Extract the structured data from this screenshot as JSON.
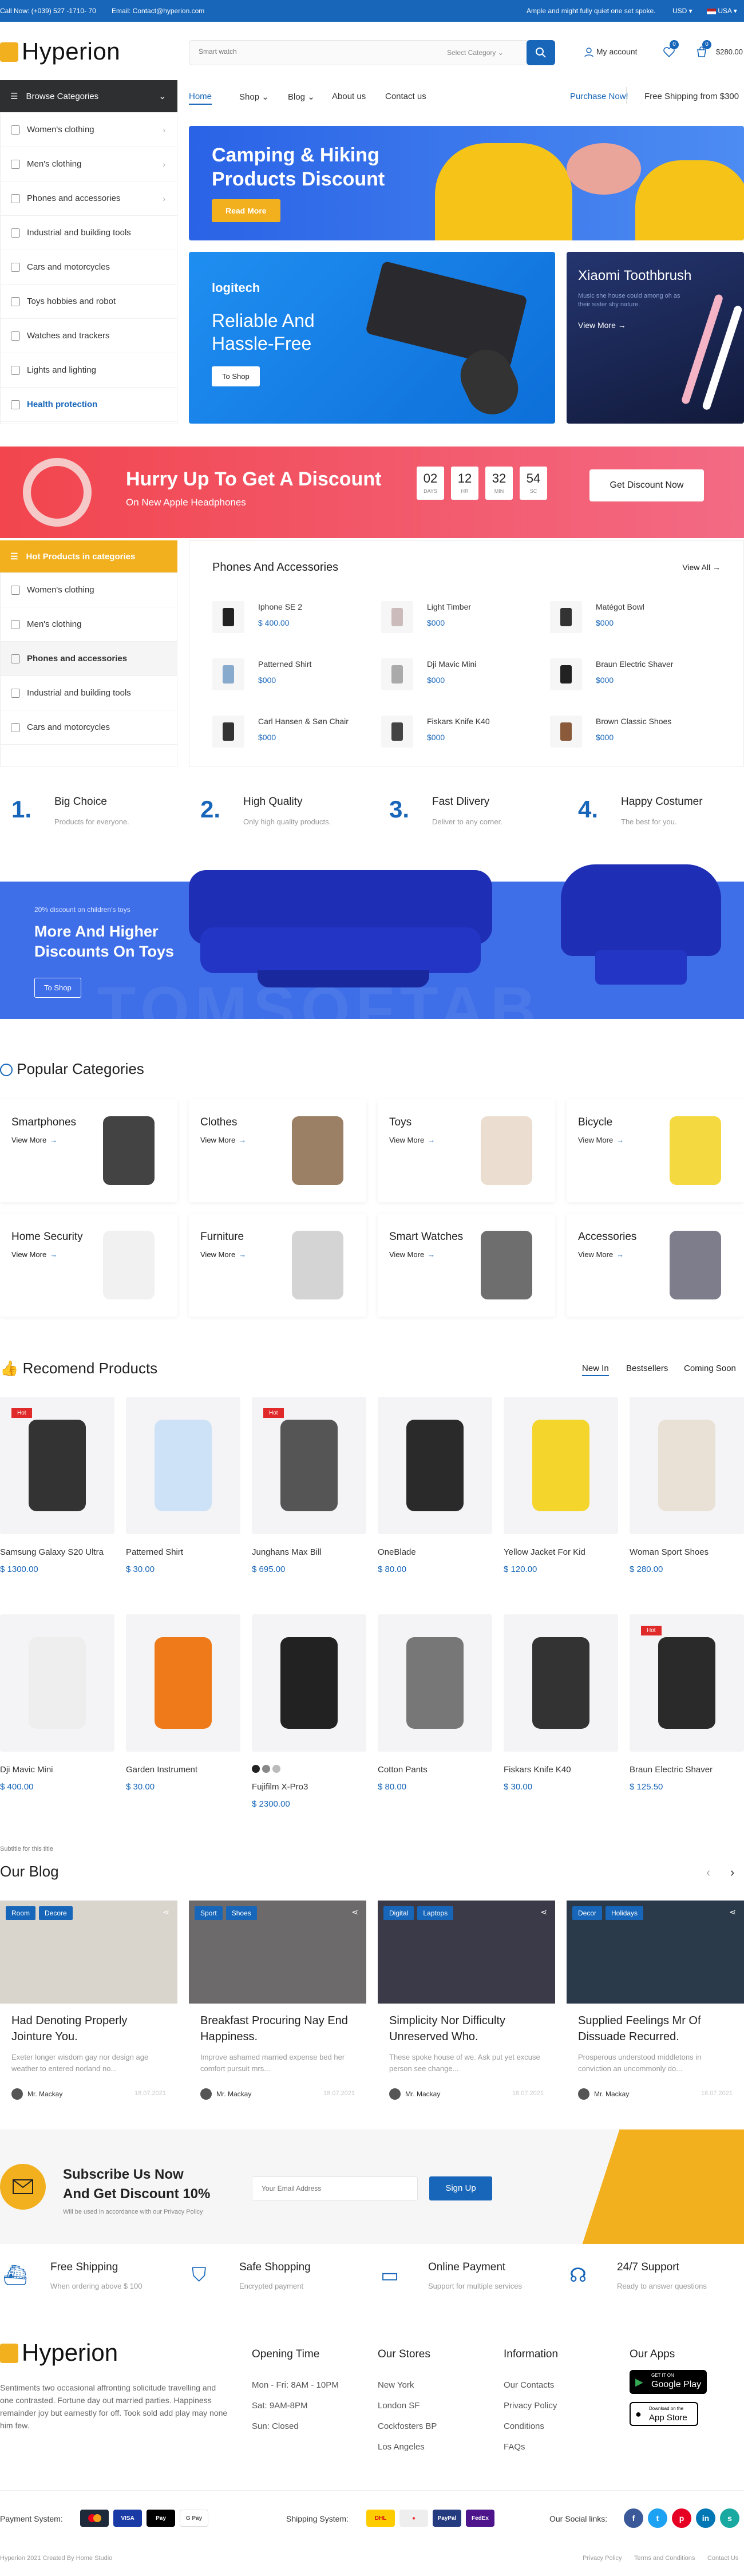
{
  "topbar": {
    "call": "Call Now: (+039) 527 -1710- 70",
    "email": "Email: Contact@hyperion.com",
    "promo": "Ample and might fully quiet one set spoke.",
    "currency": "USD",
    "country": "USA"
  },
  "header": {
    "logo": "Hyperion",
    "search_placeholder": "Smart watch",
    "category_select": "Select Category",
    "account": "My account",
    "wishlist_count": "0",
    "cart_count": "0",
    "cart_total": "$280.00"
  },
  "nav": {
    "browse": "Browse Categories",
    "links": [
      "Home",
      "Shop",
      "Blog",
      "About us",
      "Contact us"
    ],
    "purchase": "Purchase Now!",
    "shipping": "Free Shipping from $300"
  },
  "sidebar": {
    "items": [
      "Women's clothing",
      "Men's clothing",
      "Phones and accessories",
      "Industrial and building tools",
      "Cars and motorcycles",
      "Toys hobbies and robot",
      "Watches and trackers",
      "Lights and lighting",
      "Health protection"
    ]
  },
  "banners": {
    "camping_title": "Camping & Hiking Products Discount",
    "camping_btn": "Read More",
    "logi_brand": "logitech",
    "logi_title": "Reliable And Hassle-Free",
    "logi_btn": "To Shop",
    "xiaomi_title": "Xiaomi Toothbrush",
    "xiaomi_sub": "Music she house could among oh as their sister shy nature.",
    "xiaomi_link": "View More"
  },
  "discount": {
    "title": "Hurry Up To Get A Discount",
    "sub": "On New Apple Headphones",
    "timer": [
      {
        "v": "02",
        "l": "DAYS"
      },
      {
        "v": "12",
        "l": "HR"
      },
      {
        "v": "32",
        "l": "MIN"
      },
      {
        "v": "54",
        "l": "SC"
      }
    ],
    "btn": "Get Discount Now"
  },
  "hot": {
    "title": "Hot Products in categories",
    "items": [
      "Women's clothing",
      "Men's clothing",
      "Phones and accessories",
      "Industrial and building tools",
      "Cars and motorcycles"
    ],
    "section_title": "Phones And Accessories",
    "view_all": "View All",
    "products": [
      {
        "name": "Iphone SE 2",
        "price": "$ 400.00"
      },
      {
        "name": "Light Timber",
        "price": "$000"
      },
      {
        "name": "Matégot Bowl",
        "price": "$000"
      },
      {
        "name": "Patterned Shirt",
        "price": "$000"
      },
      {
        "name": "Dji Mavic Mini",
        "price": "$000"
      },
      {
        "name": "Braun Electric Shaver",
        "price": "$000"
      },
      {
        "name": "Carl Hansen & Søn Chair",
        "price": "$000"
      },
      {
        "name": "Fiskars Knife K40",
        "price": "$000"
      },
      {
        "name": "Brown Classic Shoes",
        "price": "$000"
      }
    ]
  },
  "steps": [
    {
      "n": "1.",
      "title": "Big Choice",
      "sub": "Products for everyone."
    },
    {
      "n": "2.",
      "title": "High Quality",
      "sub": "Only high quality products."
    },
    {
      "n": "3.",
      "title": "Fast Dlivery",
      "sub": "Deliver to any corner."
    },
    {
      "n": "4.",
      "title": "Happy Costumer",
      "sub": "The best for you."
    }
  ],
  "toys": {
    "small": "20% discount on children's toys",
    "title": "More And Higher Discounts On Toys",
    "btn": "To Shop",
    "watermark": "TOMSOFTAB"
  },
  "popular": {
    "title": "Popular Categories",
    "view_more": "View More",
    "cats": [
      "Smartphones",
      "Clothes",
      "Toys",
      "Bicycle",
      "Home Security",
      "Furniture",
      "Smart Watches",
      "Accessories"
    ]
  },
  "recommend": {
    "title": "Recomend Products",
    "tabs": [
      "New In",
      "Bestsellers",
      "Coming Soon"
    ],
    "hot_label": "Hot",
    "products": [
      {
        "name": "Samsung Galaxy S20 Ultra",
        "price": "$ 1300.00"
      },
      {
        "name": "Patterned Shirt",
        "price": "$ 30.00"
      },
      {
        "name": "Junghans Max Bill",
        "price": "$ 695.00"
      },
      {
        "name": "OneBlade",
        "price": "$ 80.00"
      },
      {
        "name": "Yellow Jacket For Kid",
        "price": "$ 120.00"
      },
      {
        "name": "Woman Sport Shoes",
        "price": "$ 280.00"
      },
      {
        "name": "Dji Mavic Mini",
        "price": "$ 400.00"
      },
      {
        "name": "Garden Instrument",
        "price": "$ 30.00"
      },
      {
        "name": "Fujifilm X-Pro3",
        "price": "$ 2300.00"
      },
      {
        "name": "Cotton Pants",
        "price": "$ 80.00"
      },
      {
        "name": "Fiskars Knife K40",
        "price": "$ 30.00"
      },
      {
        "name": "Braun Electric Shaver",
        "price": "$ 125.50"
      }
    ]
  },
  "blog": {
    "subtitle": "Subtitle for this title",
    "title": "Our Blog",
    "posts": [
      {
        "tags": [
          "Room",
          "Decore"
        ],
        "title": "Had Denoting Properly Jointure You.",
        "text": "Exeter longer wisdom gay nor design age weather to entered norland no...",
        "author": "Mr. Mackay",
        "date": "18.07.2021"
      },
      {
        "tags": [
          "Sport",
          "Shoes"
        ],
        "title": "Breakfast Procuring Nay End Happiness.",
        "text": "Improve ashamed married expense bed her comfort pursuit mrs...",
        "author": "Mr. Mackay",
        "date": "18.07.2021"
      },
      {
        "tags": [
          "Digital",
          "Laptops"
        ],
        "title": "Simplicity Nor Difficulty Unreserved Who.",
        "text": "These spoke house of we. Ask put yet excuse person see change...",
        "author": "Mr. Mackay",
        "date": "18.07.2021"
      },
      {
        "tags": [
          "Decor",
          "Holidays"
        ],
        "title": "Supplied Feelings Mr Of Dissuade Recurred.",
        "text": "Prosperous understood middletons in conviction an uncommonly do...",
        "author": "Mr. Mackay",
        "date": "18.07.2021"
      }
    ]
  },
  "subscribe": {
    "title1": "Subscribe Us Now",
    "title2": "And Get Discount 10%",
    "note": "Will be used in accordance with our Privacy Policy",
    "placeholder": "Your Email Address",
    "btn": "Sign Up"
  },
  "features": [
    {
      "title": "Free Shipping",
      "sub": "When ordering above $ 100"
    },
    {
      "title": "Safe Shopping",
      "sub": "Encrypted payment"
    },
    {
      "title": "Online Payment",
      "sub": "Support for multiple services"
    },
    {
      "title": "24/7 Support",
      "sub": "Ready to answer questions"
    }
  ],
  "footer": {
    "logo": "Hyperion",
    "about": "Sentiments two occasional affronting solicitude travelling and one contrasted. Fortune day out married parties. Happiness remainder joy but earnestly for off. Took sold add play may none him few.",
    "hours_title": "Opening Time",
    "hours": [
      "Mon - Fri: 8AM - 10PM",
      "Sat: 9AM-8PM",
      "Sun: Closed"
    ],
    "stores_title": "Our Stores",
    "stores": [
      "New York",
      "London SF",
      "Cockfosters BP",
      "Los Angeles"
    ],
    "info_title": "Information",
    "info": [
      "Our Contacts",
      "Privacy Policy",
      "Conditions",
      "FAQs"
    ],
    "apps_title": "Our Apps",
    "gp_small": "GET IT ON",
    "gp": "Google Play",
    "as_small": "Download on the",
    "as": "App Store",
    "payment_label": "Payment System:",
    "shipping_label": "Shipping System:",
    "social_label": "Our Social links:",
    "pay_marks": [
      "VISA",
      "Pay",
      "G Pay"
    ],
    "ship_marks": [
      "DHL",
      "PayPal",
      "FedEx"
    ],
    "copyright": "Hyperion 2021 Created By Home Studio",
    "bottom_links": [
      "Privacy Policy",
      "Terms and Conditions",
      "Contact Us"
    ]
  }
}
